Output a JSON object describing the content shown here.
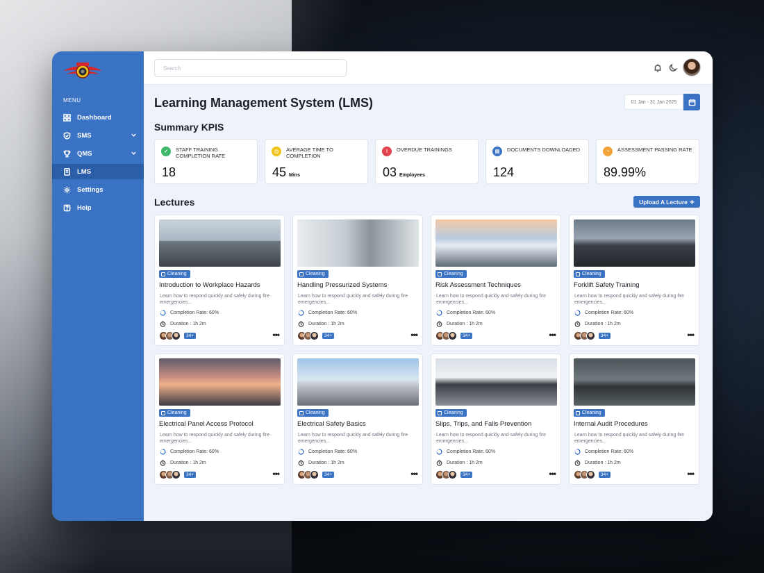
{
  "sidebar": {
    "menu_label": "MENU",
    "items": [
      {
        "label": "Dashboard",
        "icon": "grid-icon",
        "active": false,
        "has_chevron": false
      },
      {
        "label": "SMS",
        "icon": "shield-icon",
        "active": false,
        "has_chevron": true
      },
      {
        "label": "QMS",
        "icon": "trophy-icon",
        "active": false,
        "has_chevron": true
      },
      {
        "label": "LMS",
        "icon": "book-icon",
        "active": true,
        "has_chevron": false
      },
      {
        "label": "Settings",
        "icon": "gear-icon",
        "active": false,
        "has_chevron": false
      },
      {
        "label": "Help",
        "icon": "help-icon",
        "active": false,
        "has_chevron": false
      }
    ]
  },
  "topbar": {
    "search_placeholder": "Search"
  },
  "header": {
    "title": "Learning Management System (LMS)",
    "date_range": "01 Jan - 31 Jan 2025"
  },
  "kpi_section": {
    "title": "Summary KPIS",
    "items": [
      {
        "label": "STAFF TRAINING COMPLETION RATE",
        "value": "18",
        "unit": "",
        "icon_color": "#3fb86b"
      },
      {
        "label": "AVERAGE TIME TO COMPLETION",
        "value": "45",
        "unit": "Mins",
        "icon_color": "#f2c31b"
      },
      {
        "label": "OVERDUE TRAININGS",
        "value": "03",
        "unit": "Employees",
        "icon_color": "#e2434e"
      },
      {
        "label": "DOCUMENTS DOWNLOADED",
        "value": "124",
        "unit": "",
        "icon_color": "#3a72c4"
      },
      {
        "label": "ASSESSMENT PASSING RATE",
        "value": "89.99%",
        "unit": "",
        "icon_color": "#f2a33b"
      }
    ]
  },
  "lectures": {
    "title": "Lectures",
    "upload_label": "Upload A Lecture",
    "cards": [
      {
        "title": "Introduction to Workplace Hazards",
        "tag": "Cleaning",
        "desc": "Learn how to respond quickly and safely during fire emergencies...",
        "completion": "Completion Rate: 60%",
        "duration": "Duration : 1h 2m",
        "count": "34+"
      },
      {
        "title": "Handling Pressurized Systems",
        "tag": "Cleaning",
        "desc": "Learn how to respond quickly and safely during fire emergencies...",
        "completion": "Completion Rate: 60%",
        "duration": "Duration : 1h 2m",
        "count": "34+"
      },
      {
        "title": "Risk Assessment Techniques",
        "tag": "Cleaning",
        "desc": "Learn how to respond quickly and safely during fire emergencies...",
        "completion": "Completion Rate: 60%",
        "duration": "Duration : 1h 2m",
        "count": "34+"
      },
      {
        "title": "Forklift Safety Training",
        "tag": "Cleaning",
        "desc": "Learn how to respond quickly and safely during fire emergencies...",
        "completion": "Completion Rate: 60%",
        "duration": "Duration : 1h 2m",
        "count": "34+"
      },
      {
        "title": "Electrical Panel Access Protocol",
        "tag": "Cleaning",
        "desc": "Learn how to respond quickly and safely during fire emergencies...",
        "completion": "Completion Rate: 60%",
        "duration": "Duration : 1h 2m",
        "count": "34+"
      },
      {
        "title": "Electrical Safety Basics",
        "tag": "Cleaning",
        "desc": "Learn how to respond quickly and safely during fire emergencies...",
        "completion": "Completion Rate: 60%",
        "duration": "Duration : 1h 2m",
        "count": "34+"
      },
      {
        "title": "Slips, Trips, and Falls Prevention",
        "tag": "Cleaning",
        "desc": "Learn how to respond quickly and safely during fire emergencies...",
        "completion": "Completion Rate: 60%",
        "duration": "Duration : 1h 2m",
        "count": "34+"
      },
      {
        "title": "Internal Audit Procedures",
        "tag": "Cleaning",
        "desc": "Learn how to respond quickly and safely during fire emergencies...",
        "completion": "Completion Rate: 60%",
        "duration": "Duration : 1h 2m",
        "count": "34+"
      }
    ]
  },
  "colors": {
    "accent": "#3a72c4",
    "sidebar_active": "#2b5ea9",
    "page_bg": "#eef3fb"
  }
}
